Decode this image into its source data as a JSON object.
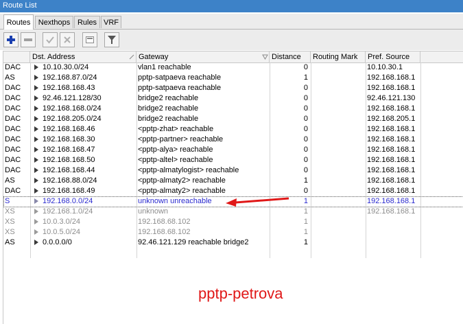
{
  "window": {
    "title": "Route List"
  },
  "tabs": [
    {
      "label": "Routes",
      "active": true
    },
    {
      "label": "Nexthops",
      "active": false
    },
    {
      "label": "Rules",
      "active": false
    },
    {
      "label": "VRF",
      "active": false
    }
  ],
  "toolbar": {
    "buttons": [
      "add-icon",
      "remove-icon",
      "enable-icon",
      "disable-icon",
      "comment-icon",
      "filter-icon"
    ]
  },
  "table": {
    "columns": [
      "",
      "Dst. Address",
      "Gateway",
      "Distance",
      "Routing Mark",
      "Pref. Source"
    ],
    "rows": [
      {
        "flags": "DAC",
        "dst": "10.10.30.0/24",
        "gateway": "vlan1 reachable",
        "distance": "0",
        "mark": "",
        "pref": "10.10.30.1",
        "state": "normal"
      },
      {
        "flags": "AS",
        "dst": "192.168.87.0/24",
        "gateway": "pptp-satpaeva reachable",
        "distance": "1",
        "mark": "",
        "pref": "192.168.168.1",
        "state": "normal"
      },
      {
        "flags": "DAC",
        "dst": "192.168.168.43",
        "gateway": "pptp-satpaeva reachable",
        "distance": "0",
        "mark": "",
        "pref": "192.168.168.1",
        "state": "normal"
      },
      {
        "flags": "DAC",
        "dst": "92.46.121.128/30",
        "gateway": "bridge2 reachable",
        "distance": "0",
        "mark": "",
        "pref": "92.46.121.130",
        "state": "normal"
      },
      {
        "flags": "DAC",
        "dst": "192.168.168.0/24",
        "gateway": "bridge2 reachable",
        "distance": "0",
        "mark": "",
        "pref": "192.168.168.1",
        "state": "normal"
      },
      {
        "flags": "DAC",
        "dst": "192.168.205.0/24",
        "gateway": "bridge2 reachable",
        "distance": "0",
        "mark": "",
        "pref": "192.168.205.1",
        "state": "normal"
      },
      {
        "flags": "DAC",
        "dst": "192.168.168.46",
        "gateway": "<pptp-zhat> reachable",
        "distance": "0",
        "mark": "",
        "pref": "192.168.168.1",
        "state": "normal"
      },
      {
        "flags": "DAC",
        "dst": "192.168.168.30",
        "gateway": "<pptp-partner> reachable",
        "distance": "0",
        "mark": "",
        "pref": "192.168.168.1",
        "state": "normal"
      },
      {
        "flags": "DAC",
        "dst": "192.168.168.47",
        "gateway": "<pptp-alya> reachable",
        "distance": "0",
        "mark": "",
        "pref": "192.168.168.1",
        "state": "normal"
      },
      {
        "flags": "DAC",
        "dst": "192.168.168.50",
        "gateway": "<pptp-altel> reachable",
        "distance": "0",
        "mark": "",
        "pref": "192.168.168.1",
        "state": "normal"
      },
      {
        "flags": "DAC",
        "dst": "192.168.168.44",
        "gateway": "<pptp-almatylogist> reachable",
        "distance": "0",
        "mark": "",
        "pref": "192.168.168.1",
        "state": "normal"
      },
      {
        "flags": "AS",
        "dst": "192.168.88.0/24",
        "gateway": "<pptp-almaty2> reachable",
        "distance": "1",
        "mark": "",
        "pref": "192.168.168.1",
        "state": "normal"
      },
      {
        "flags": "DAC",
        "dst": "192.168.168.49",
        "gateway": "<pptp-almaty2> reachable",
        "distance": "0",
        "mark": "",
        "pref": "192.168.168.1",
        "state": "normal"
      },
      {
        "flags": "S",
        "dst": "192.168.0.0/24",
        "gateway": "unknown unreachable",
        "distance": "1",
        "mark": "",
        "pref": "192.168.168.1",
        "state": "selected"
      },
      {
        "flags": "XS",
        "dst": "192.168.1.0/24",
        "gateway": "unknown",
        "distance": "1",
        "mark": "",
        "pref": "192.168.168.1",
        "state": "dim"
      },
      {
        "flags": "XS",
        "dst": "10.0.3.0/24",
        "gateway": "192.168.68.102",
        "distance": "1",
        "mark": "",
        "pref": "",
        "state": "dim"
      },
      {
        "flags": "XS",
        "dst": "10.0.5.0/24",
        "gateway": "192.168.68.102",
        "distance": "1",
        "mark": "",
        "pref": "",
        "state": "dim"
      },
      {
        "flags": "AS",
        "dst": "0.0.0.0/0",
        "gateway": "92.46.121.129 reachable bridge2",
        "distance": "1",
        "mark": "",
        "pref": "",
        "state": "normal"
      }
    ]
  },
  "annotation": {
    "caption": "pptp-petrova",
    "arrow_color": "#e01818"
  }
}
